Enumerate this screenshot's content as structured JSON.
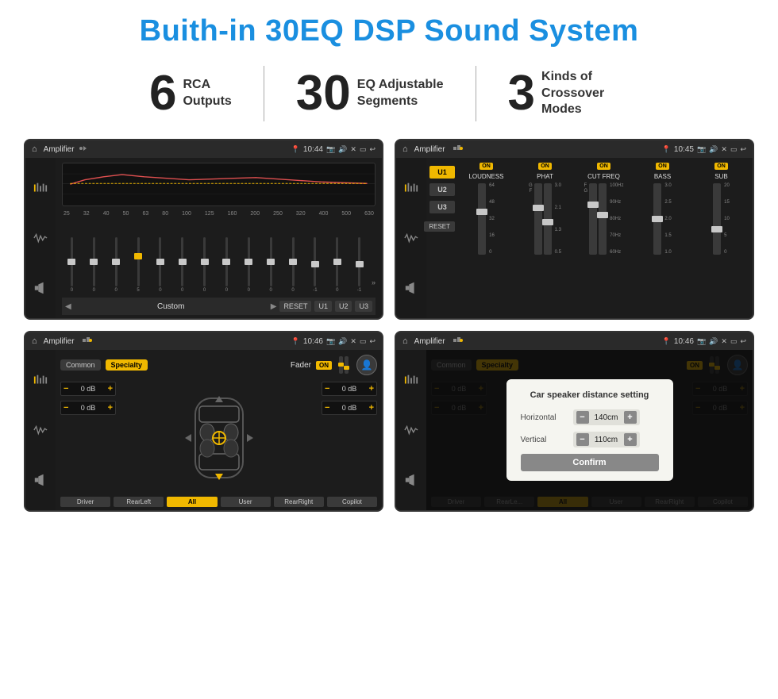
{
  "title": "Buith-in 30EQ DSP Sound System",
  "stats": [
    {
      "number": "6",
      "label": "RCA\nOutputs"
    },
    {
      "number": "30",
      "label": "EQ Adjustable\nSegments"
    },
    {
      "number": "3",
      "label": "Kinds of\nCrossover Modes"
    }
  ],
  "screens": [
    {
      "id": "screen1",
      "topbar": {
        "title": "Amplifier",
        "time": "10:44",
        "dots": 2
      },
      "type": "eq",
      "freq_labels": [
        "25",
        "32",
        "40",
        "50",
        "63",
        "80",
        "100",
        "125",
        "160",
        "200",
        "250",
        "320",
        "400",
        "500",
        "630"
      ],
      "slider_values": [
        "0",
        "0",
        "0",
        "5",
        "0",
        "0",
        "0",
        "0",
        "0",
        "0",
        "0",
        "-1",
        "0",
        "-1"
      ],
      "bottom_buttons": [
        "RESET",
        "U1",
        "U2",
        "U3"
      ],
      "preset_label": "Custom"
    },
    {
      "id": "screen2",
      "topbar": {
        "title": "Amplifier",
        "time": "10:45"
      },
      "type": "crossover",
      "presets": [
        "U1",
        "U2",
        "U3"
      ],
      "controls": [
        {
          "label": "LOUDNESS",
          "on": true
        },
        {
          "label": "PHAT",
          "on": true
        },
        {
          "label": "CUT FREQ",
          "on": true
        },
        {
          "label": "BASS",
          "on": true
        },
        {
          "label": "SUB",
          "on": true
        }
      ],
      "reset_btn": "RESET"
    },
    {
      "id": "screen3",
      "topbar": {
        "title": "Amplifier",
        "time": "10:46"
      },
      "type": "fader",
      "modes": [
        "Common",
        "Specialty"
      ],
      "fader_label": "Fader",
      "fader_on": "ON",
      "db_controls": [
        {
          "value": "0 dB"
        },
        {
          "value": "0 dB"
        },
        {
          "value": "0 dB"
        },
        {
          "value": "0 dB"
        }
      ],
      "bottom_buttons": [
        "Driver",
        "RearLeft",
        "All",
        "User",
        "RearRight",
        "Copilot"
      ],
      "active_bottom": "All"
    },
    {
      "id": "screen4",
      "topbar": {
        "title": "Amplifier",
        "time": "10:46"
      },
      "type": "fader-dialog",
      "dialog": {
        "title": "Car speaker distance setting",
        "rows": [
          {
            "label": "Horizontal",
            "value": "140cm"
          },
          {
            "label": "Vertical",
            "value": "110cm"
          }
        ],
        "confirm_label": "Confirm"
      },
      "modes": [
        "Common",
        "Specialty"
      ],
      "bottom_buttons": [
        "Driver",
        "RearLeft",
        "All",
        "User",
        "RearRight",
        "Copilot"
      ]
    }
  ]
}
